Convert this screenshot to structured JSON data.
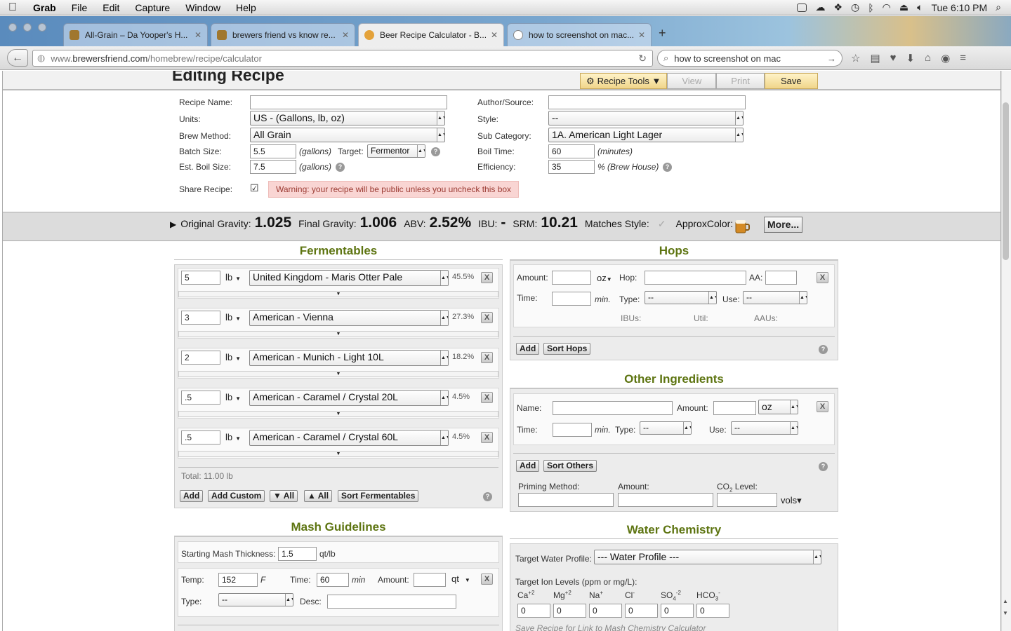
{
  "menubar": {
    "app": "Grab",
    "items": [
      "File",
      "Edit",
      "Capture",
      "Window",
      "Help"
    ],
    "clock": "Tue 6:10 PM"
  },
  "tabs": [
    {
      "title": "All-Grain – Da Yooper's H..."
    },
    {
      "title": "brewers friend vs know re..."
    },
    {
      "title": "Beer Recipe Calculator - B..."
    },
    {
      "title": "how to screenshot on mac..."
    }
  ],
  "nav": {
    "url_prefix": "www.",
    "url_host": "brewersfriend.com",
    "url_path": "/homebrew/recipe/calculator",
    "search_value": "how to screenshot on mac"
  },
  "header": {
    "title": "Editing Recipe",
    "tools_label": "Recipe Tools ▼",
    "view_label": "View",
    "print_label": "Print",
    "save_label": "Save"
  },
  "form": {
    "recipe_name_label": "Recipe Name:",
    "recipe_name": "",
    "units_label": "Units:",
    "units": "US - (Gallons, lb, oz)",
    "brew_method_label": "Brew Method:",
    "brew_method": "All Grain",
    "batch_size_label": "Batch Size:",
    "batch_size": "5.5",
    "gallons": "(gallons)",
    "target_label": "Target:",
    "target": "Fermentor",
    "boil_size_label": "Est. Boil Size:",
    "boil_size": "7.5",
    "share_label": "Share Recipe:",
    "share_warning": "Warning: your recipe will be public unless you uncheck this box",
    "author_label": "Author/Source:",
    "author": "",
    "style_label": "Style:",
    "style": "--",
    "subcat_label": "Sub Category:",
    "subcat": "1A. American Light Lager",
    "boil_time_label": "Boil Time:",
    "boil_time": "60",
    "minutes": "(minutes)",
    "efficiency_label": "Efficiency:",
    "efficiency": "35",
    "brew_house": "% (Brew House)"
  },
  "stats": {
    "og_label": "Original Gravity:",
    "og": "1.025",
    "fg_label": "Final Gravity:",
    "fg": "1.006",
    "abv_label": "ABV:",
    "abv": "2.52%",
    "ibu_label": "IBU:",
    "ibu": "-",
    "srm_label": "SRM:",
    "srm": "10.21",
    "matches_label": "Matches Style:",
    "color_label": "ApproxColor:",
    "more_label": "More..."
  },
  "fermentables": {
    "heading": "Fermentables",
    "rows": [
      {
        "amount": "5",
        "unit": "lb",
        "name": "United Kingdom - Maris Otter Pale",
        "pct": "45.5%"
      },
      {
        "amount": "3",
        "unit": "lb",
        "name": "American - Vienna",
        "pct": "27.3%"
      },
      {
        "amount": "2",
        "unit": "lb",
        "name": "American - Munich - Light 10L",
        "pct": "18.2%"
      },
      {
        "amount": ".5",
        "unit": "lb",
        "name": "American - Caramel / Crystal 20L",
        "pct": "4.5%"
      },
      {
        "amount": ".5",
        "unit": "lb",
        "name": "American - Caramel / Crystal 60L",
        "pct": "4.5%"
      }
    ],
    "total": "Total: 11.00 lb",
    "add": "Add",
    "add_custom": "Add Custom",
    "expand_all": "▼ All",
    "collapse_all": "▲ All",
    "sort": "Sort Fermentables"
  },
  "hops": {
    "heading": "Hops",
    "amount_label": "Amount:",
    "unit": "oz",
    "hop_label": "Hop:",
    "aa_label": "AA:",
    "time_label": "Time:",
    "min": "min.",
    "type_label": "Type:",
    "type": "--",
    "use_label": "Use:",
    "use": "--",
    "ibus": "IBUs:",
    "util": "Util:",
    "aaus": "AAUs:",
    "add": "Add",
    "sort": "Sort Hops"
  },
  "other": {
    "heading": "Other Ingredients",
    "name_label": "Name:",
    "amount_label": "Amount:",
    "unit": "oz",
    "time_label": "Time:",
    "min": "min.",
    "type_label": "Type:",
    "type": "--",
    "use_label": "Use:",
    "use": "--",
    "add": "Add",
    "sort": "Sort Others",
    "priming_label": "Priming Method:",
    "priming_amount_label": "Amount:",
    "co2_label": "CO",
    "co2_sub": "2",
    "co2_suffix": " Level:",
    "vols": "vols▾"
  },
  "mash": {
    "heading": "Mash Guidelines",
    "thickness_label": "Starting Mash Thickness:",
    "thickness": "1.5",
    "thickness_unit": "qt/lb",
    "temp_label": "Temp:",
    "temp": "152",
    "temp_unit": "F",
    "time_label": "Time:",
    "time": "60",
    "time_unit": "min",
    "amount_label": "Amount:",
    "amount_unit": "qt",
    "type_label": "Type:",
    "type": "--",
    "desc_label": "Desc:"
  },
  "water": {
    "heading": "Water Chemistry",
    "profile_label": "Target Water Profile:",
    "profile": "--- Water Profile ---",
    "ion_label": "Target Ion Levels (ppm or mg/L):",
    "ions": [
      {
        "base": "Ca",
        "sup": "+2",
        "sub": "",
        "value": "0"
      },
      {
        "base": "Mg",
        "sup": "+2",
        "sub": "",
        "value": "0"
      },
      {
        "base": "Na",
        "sup": "+",
        "sub": "",
        "value": "0"
      },
      {
        "base": "Cl",
        "sup": "-",
        "sub": "",
        "value": "0"
      },
      {
        "base": "SO",
        "sup": "-2",
        "sub": "4",
        "value": "0"
      },
      {
        "base": "HCO",
        "sup": "-",
        "sub": "3",
        "value": "0"
      }
    ],
    "footer": "Save Recipe for Link to Mash Chemistry Calculator"
  }
}
